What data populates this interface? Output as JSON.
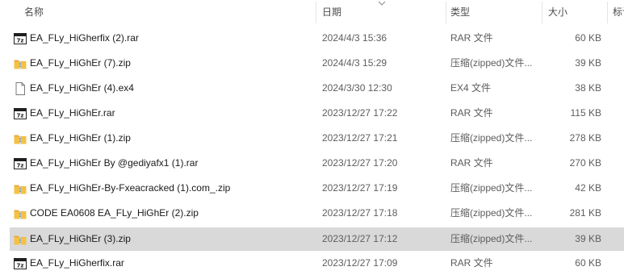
{
  "columns": {
    "name": "名称",
    "date": "日期",
    "type": "类型",
    "size": "大小",
    "tags": "标记"
  },
  "files": [
    {
      "name": "EA_FLy_HiGherfix (2).rar",
      "date": "2024/4/3 15:36",
      "type": "RAR 文件",
      "size": "60 KB",
      "icon": "rar-archive-icon",
      "selected": false
    },
    {
      "name": "EA_FLy_HiGhEr (7).zip",
      "date": "2024/4/3 15:29",
      "type": "压缩(zipped)文件...",
      "size": "39 KB",
      "icon": "zip-folder-icon",
      "selected": false
    },
    {
      "name": "EA_FLy_HiGhEr (4).ex4",
      "date": "2024/3/30 12:30",
      "type": "EX4 文件",
      "size": "38 KB",
      "icon": "generic-file-icon",
      "selected": false
    },
    {
      "name": "EA_FLy_HiGhEr.rar",
      "date": "2023/12/27 17:22",
      "type": "RAR 文件",
      "size": "115 KB",
      "icon": "rar-archive-icon",
      "selected": false
    },
    {
      "name": "EA_FLy_HiGhEr (1).zip",
      "date": "2023/12/27 17:21",
      "type": "压缩(zipped)文件...",
      "size": "278 KB",
      "icon": "zip-folder-icon",
      "selected": false
    },
    {
      "name": "EA_FLy_HiGhEr By @gediyafx1 (1).rar",
      "date": "2023/12/27 17:20",
      "type": "RAR 文件",
      "size": "270 KB",
      "icon": "rar-archive-icon",
      "selected": false
    },
    {
      "name": "EA_FLy_HiGhEr-By-Fxeacracked (1).com_.zip",
      "date": "2023/12/27 17:19",
      "type": "压缩(zipped)文件...",
      "size": "42 KB",
      "icon": "zip-folder-icon",
      "selected": false
    },
    {
      "name": "CODE EA0608 EA_FLy_HiGhEr (2).zip",
      "date": "2023/12/27 17:18",
      "type": "压缩(zipped)文件...",
      "size": "281 KB",
      "icon": "zip-folder-icon",
      "selected": false
    },
    {
      "name": "EA_FLy_HiGhEr (3).zip",
      "date": "2023/12/27 17:12",
      "type": "压缩(zipped)文件...",
      "size": "39 KB",
      "icon": "zip-folder-icon",
      "selected": true
    },
    {
      "name": "EA_FLy_HiGherfix.rar",
      "date": "2023/12/27 17:09",
      "type": "RAR 文件",
      "size": "60 KB",
      "icon": "rar-archive-icon",
      "selected": false
    }
  ],
  "colors": {
    "selected_row": "#d9d9d9",
    "zip_folder": "#f3c244",
    "rar_icon": "#1f1f1f"
  }
}
